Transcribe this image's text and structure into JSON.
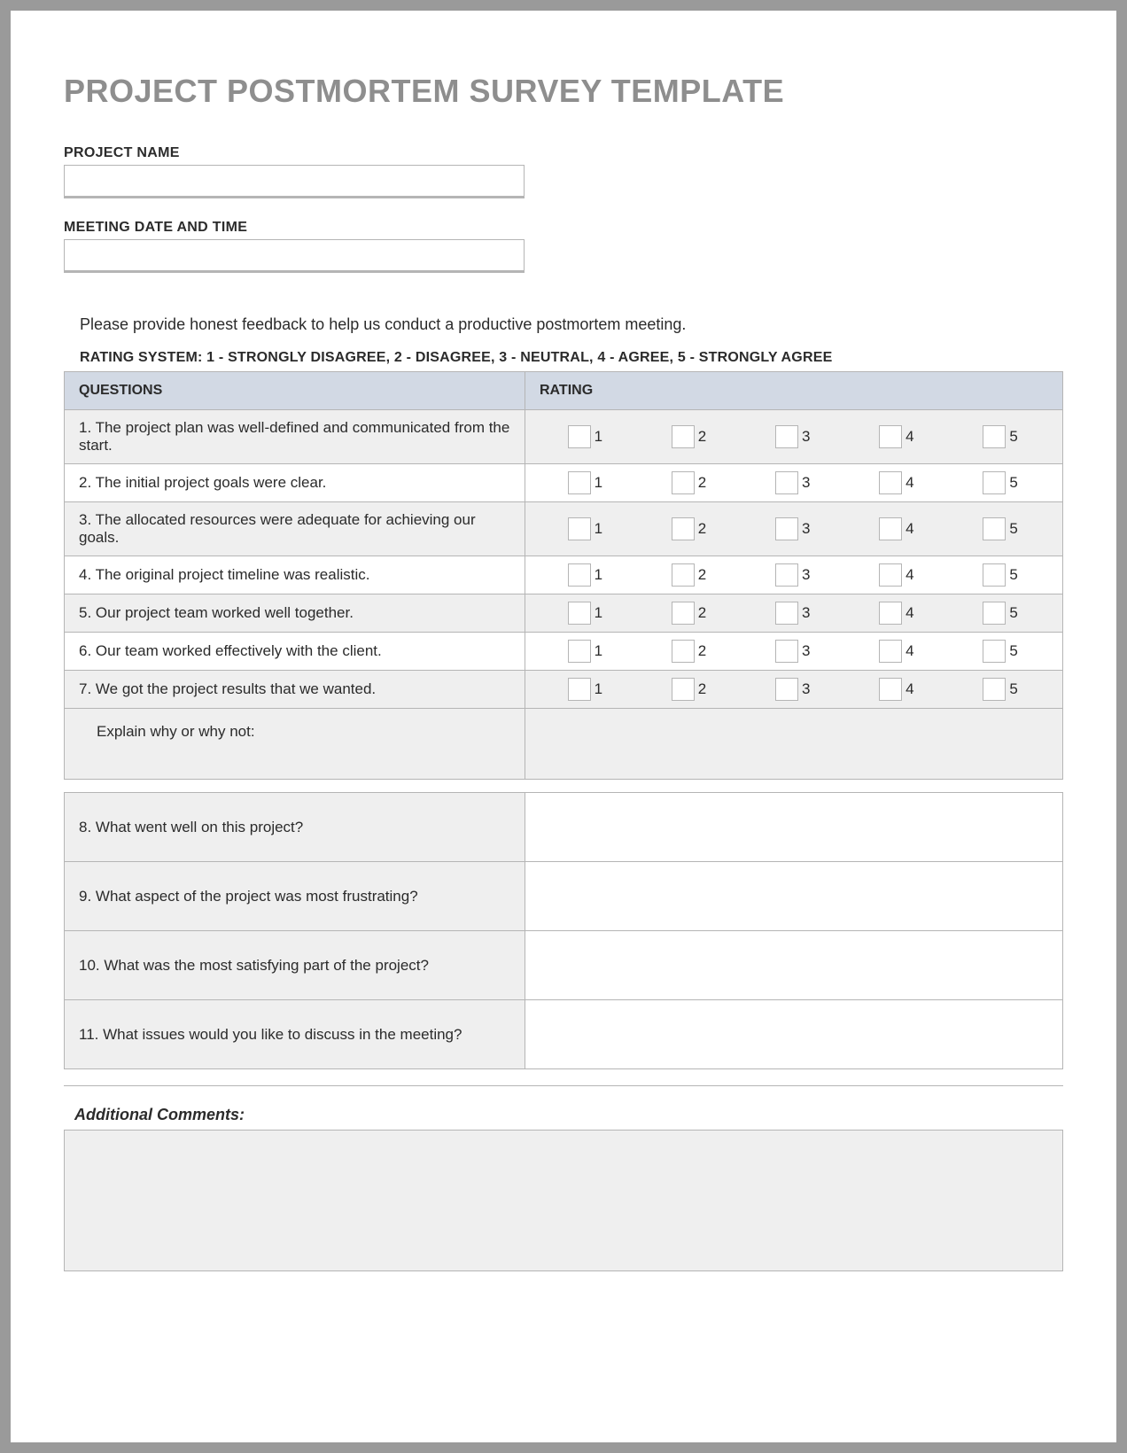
{
  "title": "PROJECT POSTMORTEM SURVEY TEMPLATE",
  "fields": {
    "project_name_label": "PROJECT NAME",
    "project_name_value": "",
    "meeting_label": "MEETING DATE AND TIME",
    "meeting_value": ""
  },
  "instructions": "Please provide honest feedback to help us conduct a productive postmortem meeting.",
  "rating_legend": "RATING SYSTEM: 1 - STRONGLY DISAGREE, 2 - DISAGREE, 3 - NEUTRAL, 4 - AGREE, 5 - STRONGLY AGREE",
  "headers": {
    "questions": "QUESTIONS",
    "rating": "RATING"
  },
  "rating_values": [
    "1",
    "2",
    "3",
    "4",
    "5"
  ],
  "questions": [
    "1. The project plan was well-defined and communicated from the start.",
    "2. The initial project goals were clear.",
    "3. The allocated resources were adequate for achieving our goals.",
    "4. The original project timeline was realistic.",
    "5. Our project team worked well together.",
    "6. Our team worked effectively with the client.",
    "7. We got the project results that we wanted."
  ],
  "explain_label": "Explain why or why not:",
  "open_questions": [
    "8. What went well on this project?",
    "9. What aspect of the project was most frustrating?",
    "10. What was the most satisfying part of the project?",
    "11. What issues would you like to discuss in the meeting?"
  ],
  "comments_label": "Additional Comments:",
  "comments_value": ""
}
